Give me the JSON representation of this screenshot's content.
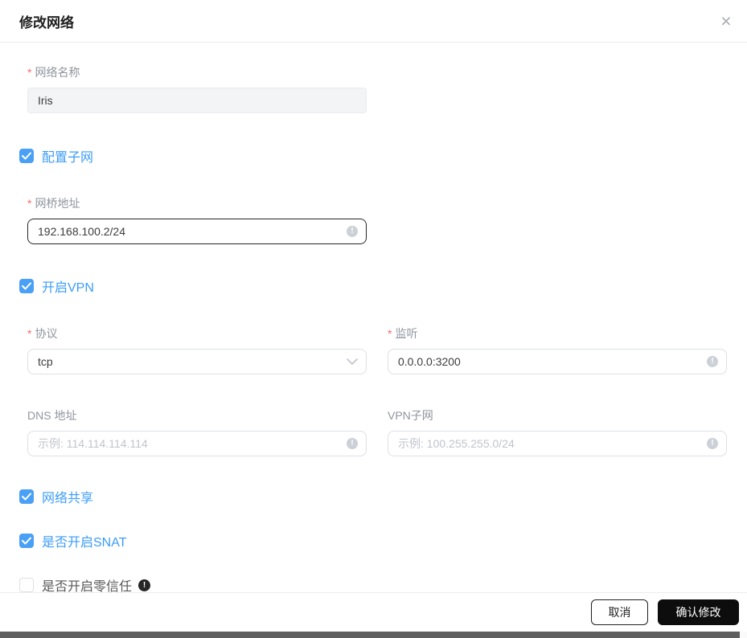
{
  "modal": {
    "title": "修改网络"
  },
  "required_mark": "*",
  "fields": {
    "network_name": {
      "label": "网络名称",
      "value": "Iris",
      "disabled": true
    },
    "bridge_address": {
      "label": "网桥地址",
      "value": "192.168.100.2/24"
    },
    "protocol": {
      "label": "协议",
      "value": "tcp"
    },
    "listen": {
      "label": "监听",
      "value": "0.0.0.0:3200"
    },
    "dns_address": {
      "label": "DNS 地址",
      "placeholder": "示例: 114.114.114.114"
    },
    "vpn_subnet": {
      "label": "VPN子网",
      "placeholder": "示例: 100.255.255.0/24"
    }
  },
  "checkboxes": {
    "configure_subnet": {
      "label": "配置子网",
      "checked": true
    },
    "enable_vpn": {
      "label": "开启VPN",
      "checked": true
    },
    "network_sharing": {
      "label": "网络共享",
      "checked": true
    },
    "enable_snat": {
      "label": "是否开启SNAT",
      "checked": true
    },
    "enable_zero_trust": {
      "label": "是否开启零信任",
      "checked": false
    }
  },
  "footer": {
    "cancel_label": "取消",
    "confirm_label": "确认修改"
  },
  "colors": {
    "accent_blue": "#3b9cf8",
    "checkbox_blue": "#4aa0f5",
    "required_red": "#f56c6c",
    "label_gray": "#8f959e",
    "placeholder_gray": "#c0c4cc",
    "input_border": "#dcdfe6",
    "focused_border": "#262626",
    "confirm_button_bg": "#0d0d0d",
    "scrollbar_thumb": "#5f5f5f"
  }
}
